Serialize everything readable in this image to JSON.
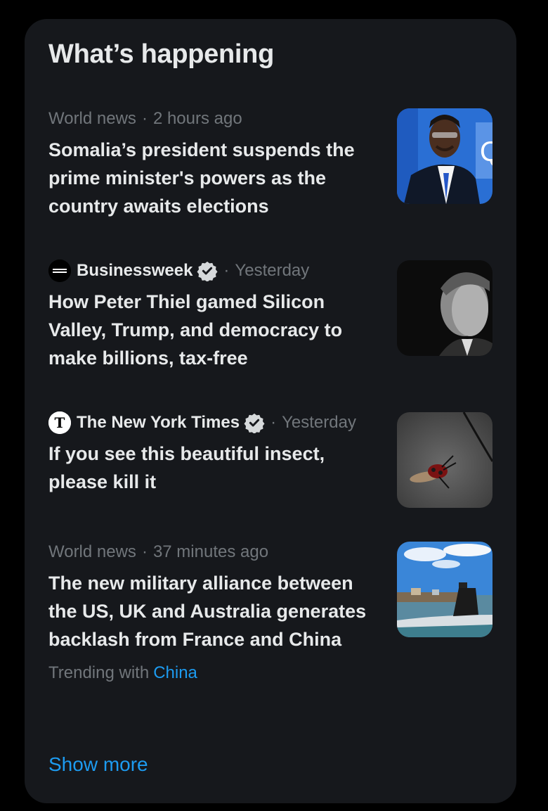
{
  "panel": {
    "title": "What’s happening"
  },
  "items": [
    {
      "category": "World news",
      "separator": "·",
      "time": "2 hours ago",
      "headline": "Somalia’s president suspends the prime minister's powers as the country awaits elections",
      "thumbnail": "president-photo"
    },
    {
      "source": "Businessweek",
      "source_logo": "businessweek-logo",
      "verified": true,
      "separator": "·",
      "time": "Yesterday",
      "headline": "How Peter Thiel gamed Silicon Valley, Trump, and democracy to make billions, tax-free",
      "thumbnail": "portrait-photo"
    },
    {
      "source": "The New York Times",
      "source_logo": "nyt-logo",
      "verified": true,
      "separator": "·",
      "time": "Yesterday",
      "headline": "If you see this beautiful insect, please kill it",
      "thumbnail": "insect-photo"
    },
    {
      "category": "World news",
      "separator": "·",
      "time": "37 minutes ago",
      "headline": "The new military alliance between the US, UK and Australia generates backlash from France and China",
      "thumbnail": "submarine-photo",
      "trending_label": "Trending with",
      "trending_topic": "China"
    }
  ],
  "show_more": "Show more",
  "colors": {
    "background": "#000000",
    "panel": "#16181c",
    "text_primary": "#e7e9ea",
    "text_secondary": "#71767b",
    "accent": "#1d9bf0"
  }
}
